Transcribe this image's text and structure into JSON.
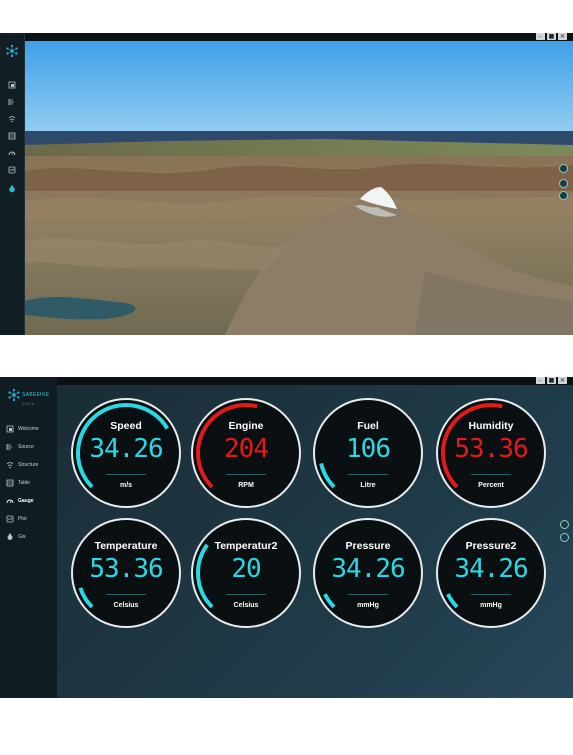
{
  "window_controls": [
    "–",
    "■",
    "✕"
  ],
  "viewer": {
    "sidebar_icons": [
      "layers-icon",
      "source-icon",
      "structure-icon",
      "table-icon",
      "gauge-icon",
      "plot-icon",
      "gis-icon"
    ],
    "map_controls": [
      "compass-icon",
      "zoom-in-icon",
      "zoom-out-icon"
    ]
  },
  "dashboard": {
    "brand": "SABEEHIE",
    "brand_sub": "DATA",
    "nav": [
      {
        "label": "Welcome",
        "icon": "welcome-icon"
      },
      {
        "label": "Source",
        "icon": "source-icon"
      },
      {
        "label": "Structure",
        "icon": "structure-icon"
      },
      {
        "label": "Table",
        "icon": "table-icon"
      },
      {
        "label": "Gauge",
        "icon": "gauge-icon",
        "active": true
      },
      {
        "label": "Plot",
        "icon": "plot-icon"
      },
      {
        "label": "Gis",
        "icon": "gis-icon"
      }
    ],
    "side_controls": [
      "target-icon",
      "close-icon"
    ],
    "gauges": [
      {
        "title": "Speed",
        "value": "34.26",
        "unit": "m/s",
        "color": "#29d8e3",
        "level": 0.72
      },
      {
        "title": "Engine",
        "value": "204",
        "unit": "RPM",
        "color": "#e31a1a",
        "level": 0.55
      },
      {
        "title": "Fuel",
        "value": "106",
        "unit": "Litre",
        "color": "#29d8e3",
        "level": 0.12
      },
      {
        "title": "Humidity",
        "value": "53.36",
        "unit": "Percent",
        "color": "#e31a1a",
        "level": 0.55
      },
      {
        "title": "Temperature",
        "value": "53.36",
        "unit": "Celsius",
        "color": "#29d8e3",
        "level": 0.1
      },
      {
        "title": "Temperatur2",
        "value": "20",
        "unit": "Celsius",
        "color": "#29d8e3",
        "level": 0.3
      },
      {
        "title": "Pressure",
        "value": "34.26",
        "unit": "mmHg",
        "color": "#29d8e3",
        "level": 0.07
      },
      {
        "title": "Pressure2",
        "value": "34.26",
        "unit": "mmHg",
        "color": "#29d8e3",
        "level": 0.07
      }
    ]
  }
}
